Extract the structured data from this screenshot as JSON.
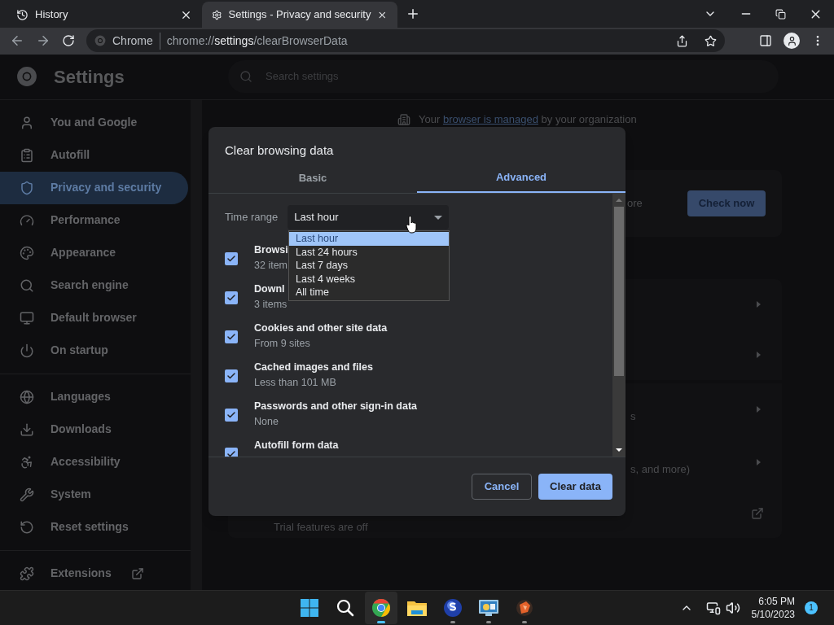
{
  "browser_tabs": [
    {
      "title": "History",
      "selected": false
    },
    {
      "title": "Settings - Privacy and security",
      "selected": true
    }
  ],
  "address_bar": {
    "site_label": "Chrome",
    "url_prefix": "chrome://",
    "url_host": "settings",
    "url_path": "/clearBrowserData"
  },
  "settings_header": {
    "title": "Settings",
    "search_placeholder": "Search settings"
  },
  "sidebar": {
    "groups": [
      {
        "items": [
          {
            "label": "You and Google",
            "selected": false,
            "kind": "page"
          },
          {
            "label": "Autofill",
            "selected": false,
            "kind": "page"
          },
          {
            "label": "Privacy and security",
            "selected": true,
            "kind": "page"
          },
          {
            "label": "Performance",
            "selected": false,
            "kind": "page"
          },
          {
            "label": "Appearance",
            "selected": false,
            "kind": "page"
          },
          {
            "label": "Search engine",
            "selected": false,
            "kind": "page"
          },
          {
            "label": "Default browser",
            "selected": false,
            "kind": "page"
          },
          {
            "label": "On startup",
            "selected": false,
            "kind": "page"
          }
        ]
      },
      {
        "items": [
          {
            "label": "Languages",
            "selected": false,
            "kind": "page"
          },
          {
            "label": "Downloads",
            "selected": false,
            "kind": "page"
          },
          {
            "label": "Accessibility",
            "selected": false,
            "kind": "page"
          },
          {
            "label": "System",
            "selected": false,
            "kind": "page"
          },
          {
            "label": "Reset settings",
            "selected": false,
            "kind": "page"
          }
        ]
      },
      {
        "items": [
          {
            "label": "Extensions",
            "selected": false,
            "kind": "external"
          }
        ]
      }
    ]
  },
  "main": {
    "managed_notice": {
      "before": "Your",
      "link": "browser is managed",
      "after": "by your organization"
    },
    "safety_check_fragment": "ore",
    "check_now_button": "Check now",
    "row_fragments": [
      "s",
      "s, and more)"
    ],
    "trial_text": "Trial features are off"
  },
  "dialog": {
    "title": "Clear browsing data",
    "tabs": [
      {
        "label": "Basic",
        "selected": false
      },
      {
        "label": "Advanced",
        "selected": true
      }
    ],
    "time_range": {
      "label": "Time range",
      "value": "Last hour",
      "options": [
        {
          "label": "Last hour",
          "selected": true
        },
        {
          "label": "Last 24 hours",
          "selected": false
        },
        {
          "label": "Last 7 days",
          "selected": false
        },
        {
          "label": "Last 4 weeks",
          "selected": false
        },
        {
          "label": "All time",
          "selected": false
        }
      ]
    },
    "items": [
      {
        "title": "Browsi",
        "detail": "32 item",
        "checked": true
      },
      {
        "title": "Downl",
        "detail": "3 items",
        "checked": true
      },
      {
        "title": "Cookies and other site data",
        "detail": "From 9 sites",
        "checked": true
      },
      {
        "title": "Cached images and files",
        "detail": "Less than 101 MB",
        "checked": true
      },
      {
        "title": "Passwords and other sign-in data",
        "detail": "None",
        "checked": true
      },
      {
        "title": "Autofill form data",
        "checked": true
      }
    ],
    "cancel_button": "Cancel",
    "confirm_button": "Clear data"
  },
  "taskbar": {
    "apps": [
      {
        "kind": "start",
        "active": false,
        "running": false
      },
      {
        "kind": "search",
        "active": false,
        "running": false
      },
      {
        "kind": "chrome",
        "active": true
      },
      {
        "kind": "files",
        "active": false,
        "running": false
      },
      {
        "kind": "s-app",
        "active": false,
        "running": true
      },
      {
        "kind": "monitor-app",
        "active": false,
        "running": true
      },
      {
        "kind": "bird-app",
        "active": false,
        "running": true
      }
    ],
    "clock": {
      "time": "6:05 PM",
      "date": "5/10/2023"
    },
    "notification_count": "1"
  }
}
